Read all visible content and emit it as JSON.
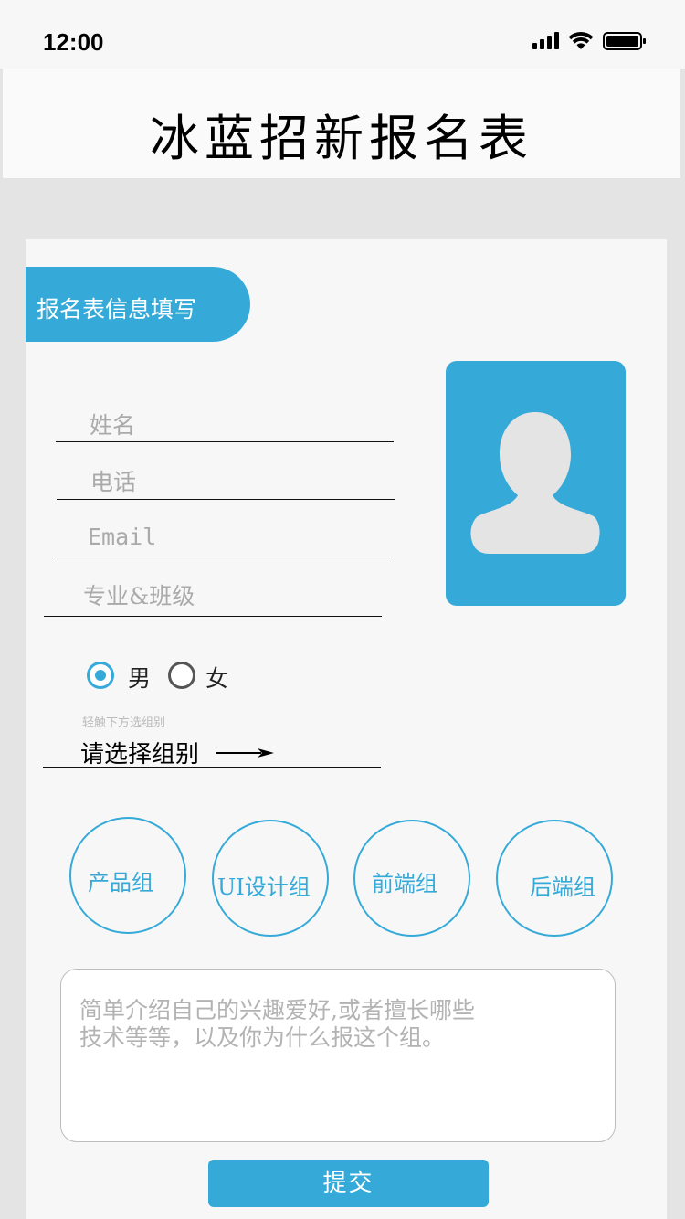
{
  "status_bar": {
    "time": "12:00"
  },
  "header": {
    "title": "冰蓝招新报名表"
  },
  "form": {
    "section_label": "报名表信息填写",
    "fields": {
      "name_placeholder": "姓名",
      "phone_placeholder": "电话",
      "email_placeholder": "Email",
      "major_placeholder": "专业&班级"
    },
    "gender": {
      "male_label": "男",
      "female_label": "女",
      "selected": "男"
    },
    "group_hint": "轻触下方选组别",
    "group_select_label": "请选择组别",
    "groups": [
      "产品组",
      "UI设计组",
      "前端组",
      "后端组"
    ],
    "intro_placeholder_line1": "简单介绍自己的兴趣爱好,或者擅长哪些",
    "intro_placeholder_line2": "技术等等，以及你为什么报这个组。",
    "submit_label": "提交"
  },
  "colors": {
    "accent": "#35aad9",
    "background": "#e4e4e4",
    "card": "#f7f7f7"
  },
  "icons": [
    "signal-icon",
    "wifi-icon",
    "battery-icon",
    "avatar-silhouette-icon",
    "arrow-right-icon"
  ]
}
